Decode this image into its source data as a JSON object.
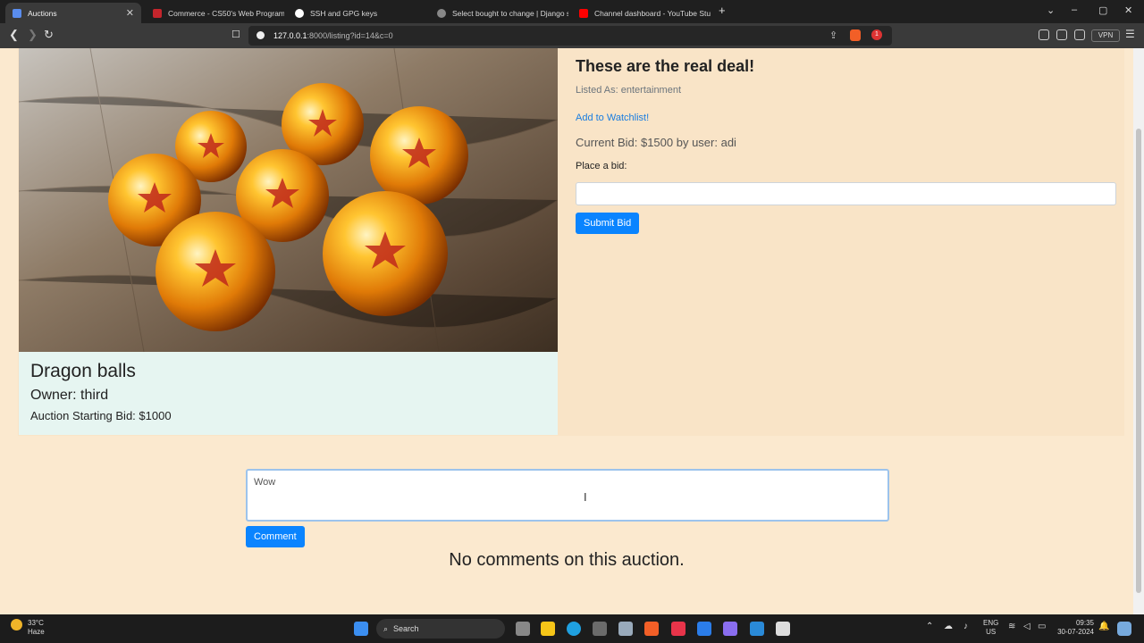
{
  "browser": {
    "tabs": [
      {
        "label": "Auctions",
        "active": true,
        "color": "#5a8dee"
      },
      {
        "label": "Commerce - CS50's Web Programm",
        "active": false,
        "color": "#c4252c"
      },
      {
        "label": "SSH and GPG keys",
        "active": false,
        "color": "#ffffff"
      },
      {
        "label": "Select bought to change | Django s",
        "active": false,
        "color": "#888888"
      },
      {
        "label": "Channel dashboard - YouTube Studi",
        "active": false,
        "color": "#ff0000"
      }
    ],
    "url_host": "127.0.0.1",
    "url_path": ":8000/listing?id=14&c=0",
    "vpn_label": "VPN",
    "notification_count": "1"
  },
  "listing": {
    "image_alt": "Dragon balls image",
    "name": "Dragon balls",
    "owner": "Owner: third",
    "starting_bid": "Auction Starting Bid: $1000",
    "description": "These are the real deal!",
    "category": "Listed As: entertainment",
    "watchlist_label": "Add to Watchlist!",
    "current_bid": "Current Bid: $1500 by user: adi",
    "place_bid_label": "Place a bid:",
    "submit_bid_label": "Submit Bid"
  },
  "comments": {
    "input_value": "Wow",
    "comment_button": "Comment",
    "empty_message": "No comments on this auction."
  },
  "taskbar": {
    "temperature": "33°C",
    "weather": "Haze",
    "search_placeholder": "Search",
    "lang_top": "ENG",
    "lang_bottom": "US",
    "time": "09:35",
    "date": "30-07-2024"
  },
  "colors": {
    "page_bg": "#fbe9cf",
    "accent": "#0a84ff",
    "info_bg": "#e6f5f1"
  }
}
